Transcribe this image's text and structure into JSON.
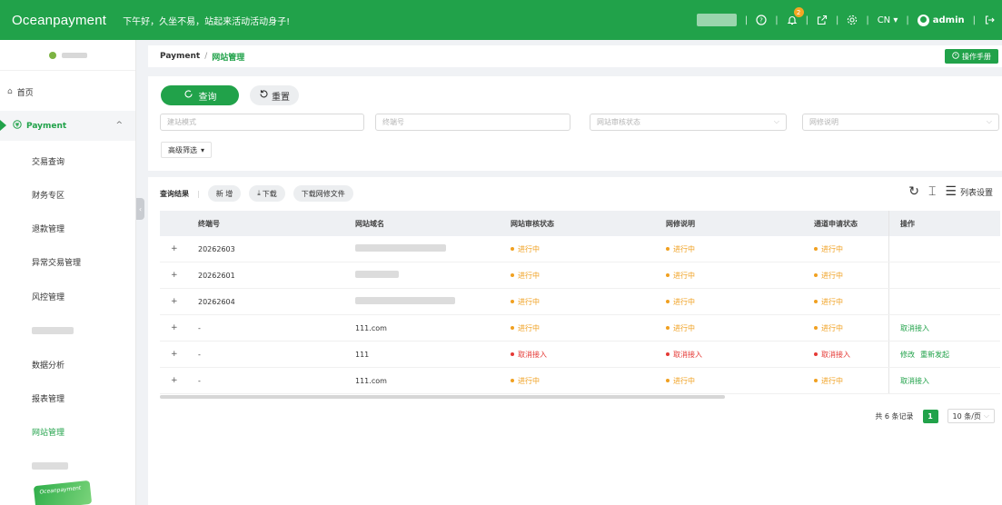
{
  "header": {
    "logo": "Oceanpayment",
    "greeting": "下午好，久坐不易，站起来活动活动身子!",
    "notification_count": "2",
    "language": "CN",
    "user": "admin",
    "colors": {
      "brand": "#21a24a",
      "badge": "#f5a623"
    }
  },
  "sidebar": {
    "home": "首页",
    "group": "Payment",
    "items": [
      "交易查询",
      "财务专区",
      "退款管理",
      "异常交易管理",
      "风控管理",
      "",
      "数据分析",
      "报表管理",
      "网站管理"
    ],
    "active": "网站管理",
    "card_text": "Oceanpayment"
  },
  "breadcrumb": {
    "root": "Payment",
    "separator": "/",
    "current": "网站管理",
    "manual_button": "操作手册"
  },
  "filter": {
    "query_button": "查询",
    "reset_button": "重置",
    "fields": {
      "site_domain_placeholder": "建站模式",
      "terminal_placeholder": "终端号",
      "review_status_placeholder": "网站审核状态",
      "modify_note_placeholder": "网修说明"
    },
    "advanced_button": "高级筛选"
  },
  "results": {
    "label": "查询结果",
    "add_button": "新 增",
    "download_button": "下载",
    "download_file_button": "下载网修文件",
    "list_settings": "列表设置",
    "columns": [
      "终端号",
      "网站域名",
      "网站审核状态",
      "网修说明",
      "通道申请状态",
      "操作"
    ],
    "rows": [
      {
        "terminal": "20262603",
        "domain": "",
        "review": "进行中",
        "review_color": "orange",
        "note": "进行中",
        "note_color": "orange",
        "channel": "进行中",
        "channel_color": "orange",
        "actions": []
      },
      {
        "terminal": "20262601",
        "domain": "",
        "review": "进行中",
        "review_color": "orange",
        "note": "进行中",
        "note_color": "orange",
        "channel": "进行中",
        "channel_color": "orange",
        "actions": []
      },
      {
        "terminal": "20262604",
        "domain": "",
        "review": "进行中",
        "review_color": "orange",
        "note": "进行中",
        "note_color": "orange",
        "channel": "进行中",
        "channel_color": "orange",
        "actions": []
      },
      {
        "terminal": "-",
        "domain": "111.com",
        "review": "进行中",
        "review_color": "orange",
        "note": "进行中",
        "note_color": "orange",
        "channel": "进行中",
        "channel_color": "orange",
        "actions": [
          "取消接入"
        ]
      },
      {
        "terminal": "-",
        "domain": "111",
        "review": "取消接入",
        "review_color": "red",
        "note": "取消接入",
        "note_color": "red",
        "channel": "取消接入",
        "channel_color": "red",
        "actions": [
          "修改",
          "重新发起"
        ]
      },
      {
        "terminal": "-",
        "domain": "111.com",
        "review": "进行中",
        "review_color": "orange",
        "note": "进行中",
        "note_color": "orange",
        "channel": "进行中",
        "channel_color": "orange",
        "actions": [
          "取消接入"
        ]
      }
    ],
    "pagination": {
      "total": "共 6 条记录",
      "current_page": "1",
      "page_size": "10 条/页"
    }
  }
}
